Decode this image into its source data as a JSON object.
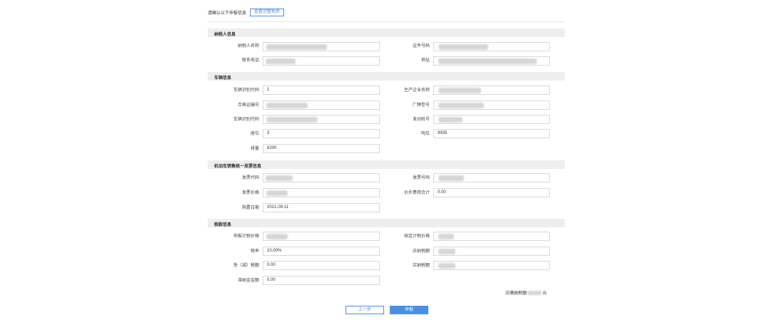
{
  "top": {
    "note": "请确认以下申报信息",
    "view_button": "查看完整税票"
  },
  "sections": {
    "taxpayer": "纳税人信息",
    "vehicle": "车辆信息",
    "invoice": "机动车销售统一发票信息",
    "tax": "税款信息"
  },
  "taxpayer": {
    "name_label": "纳税人名称",
    "id_label": "证件号码",
    "phone_label": "联系电话",
    "address_label": "地址"
  },
  "vehicle": {
    "id_code_label": "车辆识别代码",
    "id_code_value": "1",
    "maker_label": "生产企业名称",
    "cert_label": "合格证编号",
    "model_label": "厂牌型号",
    "vin_label": "车辆识别代码",
    "engine_label": "发动机号",
    "seats_label": "座位",
    "seats_value": "3",
    "tonnage_label": "吨位",
    "tonnage_value": "9935",
    "displacement_label": "排量",
    "displacement_value": "6200"
  },
  "invoice": {
    "code_label": "发票代码",
    "number_label": "发票号码",
    "price_label": "发票价格",
    "extra_label": "价外费用合计",
    "extra_value": "0.00",
    "date_label": "购置日期",
    "date_value": "2021-09-11"
  },
  "tax": {
    "declared_label": "申报计税价格",
    "assessed_label": "核定计税价格",
    "rate_label": "税率",
    "rate_value": "10.00%",
    "payable_label": "应纳税额",
    "reduction_label": "免（减）税额",
    "reduction_value": "0.00",
    "actual_label": "实纳税额",
    "penalty_label": "滞纳金金额",
    "penalty_value": "0.00",
    "total_prefix": "应缴纳税额",
    "total_suffix": "元"
  },
  "buttons": {
    "prev": "上一步",
    "submit": "申报"
  }
}
